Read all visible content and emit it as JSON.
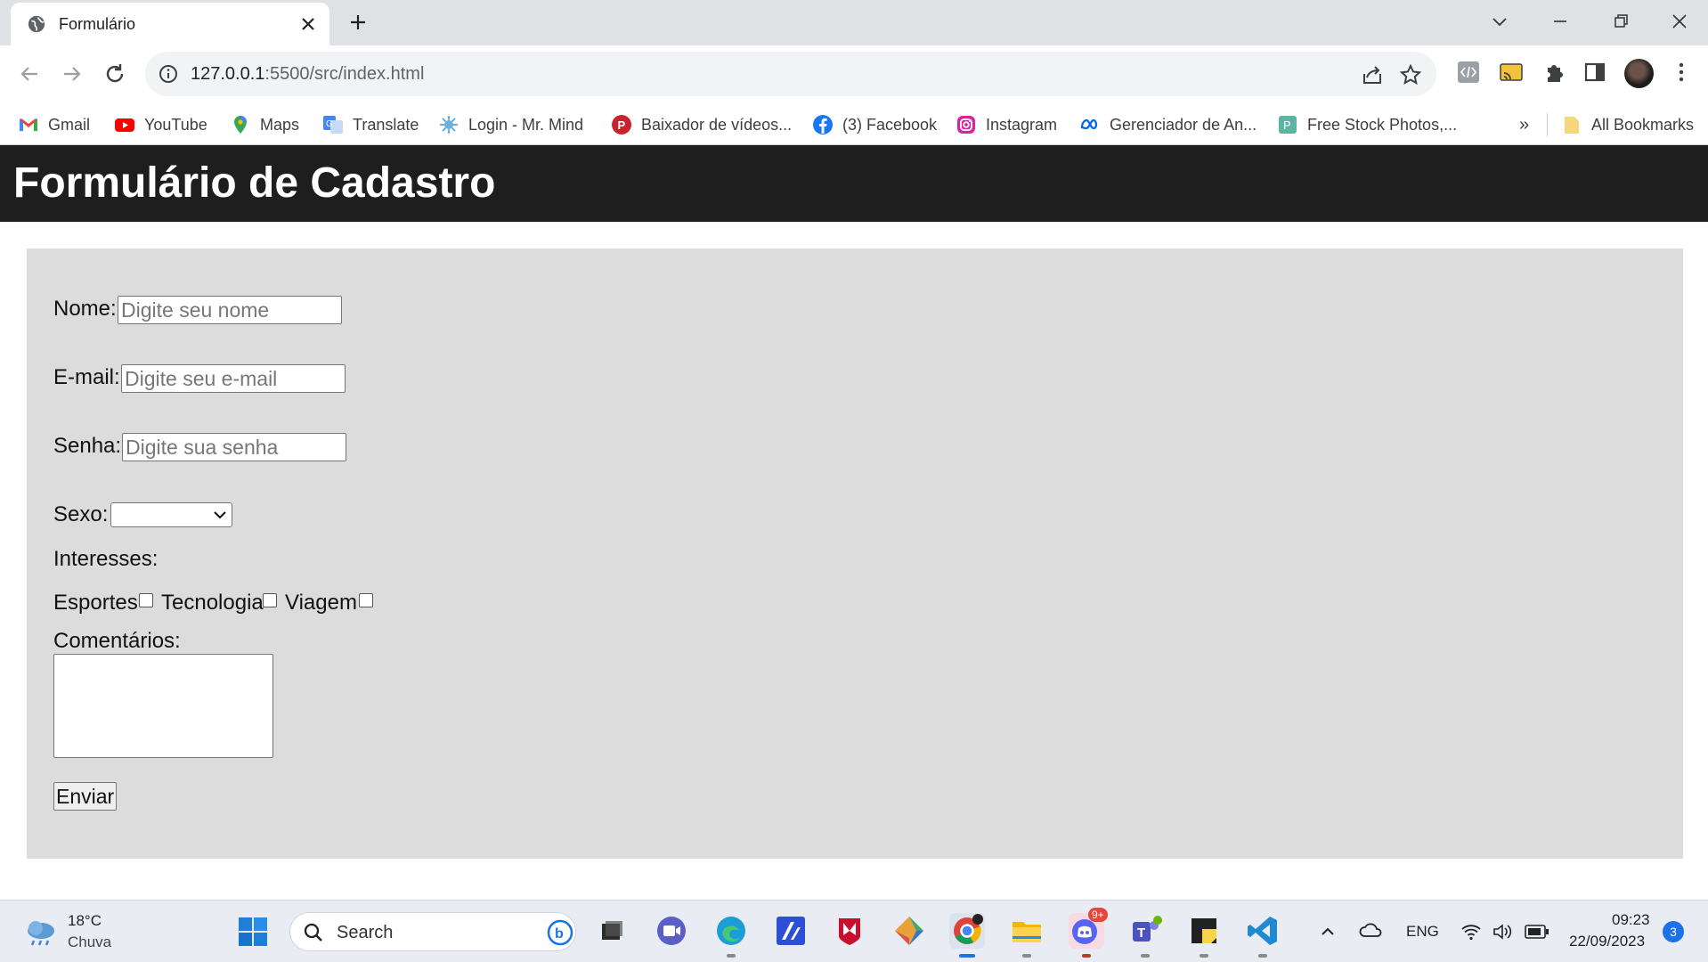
{
  "browser": {
    "tab_title": "Formulário",
    "url_host": "127.0.0.1",
    "url_path": ":5500/src/index.html"
  },
  "bookmarks": [
    {
      "label": "Gmail",
      "icon": "gmail-icon"
    },
    {
      "label": "YouTube",
      "icon": "youtube-icon"
    },
    {
      "label": "Maps",
      "icon": "maps-icon"
    },
    {
      "label": "Translate",
      "icon": "translate-icon"
    },
    {
      "label": "Login - Mr. Mind",
      "icon": "mrmind-icon"
    },
    {
      "label": "Baixador de vídeos...",
      "icon": "pinterest-icon"
    },
    {
      "label": "(3) Facebook",
      "icon": "facebook-icon"
    },
    {
      "label": "Instagram",
      "icon": "instagram-icon"
    },
    {
      "label": "Gerenciador de An...",
      "icon": "meta-icon"
    },
    {
      "label": "Free Stock Photos,...",
      "icon": "pexels-icon"
    }
  ],
  "bookmarks_overflow": "»",
  "all_bookmarks": "All Bookmarks",
  "page": {
    "title": "Formulário de Cadastro"
  },
  "form": {
    "name_label": "Nome:",
    "name_placeholder": "Digite seu nome",
    "email_label": "E-mail:",
    "email_placeholder": "Digite seu e-mail",
    "password_label": "Senha:",
    "password_placeholder": "Digite sua senha",
    "gender_label": "Sexo:",
    "gender_selected": "",
    "interests_label": "Interesses:",
    "interests": [
      "Esportes",
      "Tecnologia",
      "Viagem"
    ],
    "comments_label": "Comentários:",
    "submit_label": "Enviar"
  },
  "taskbar": {
    "weather_temp": "18°C",
    "weather_desc": "Chuva",
    "search_text": "Search",
    "language": "ENG",
    "time": "09:23",
    "date": "22/09/2023",
    "notification_count": "3",
    "discord_badge": "9+"
  },
  "colors": {
    "page_header_bg": "#1e1e1e",
    "form_bg": "#dcdcdc",
    "tabstrip_bg": "#dfe1e5"
  }
}
